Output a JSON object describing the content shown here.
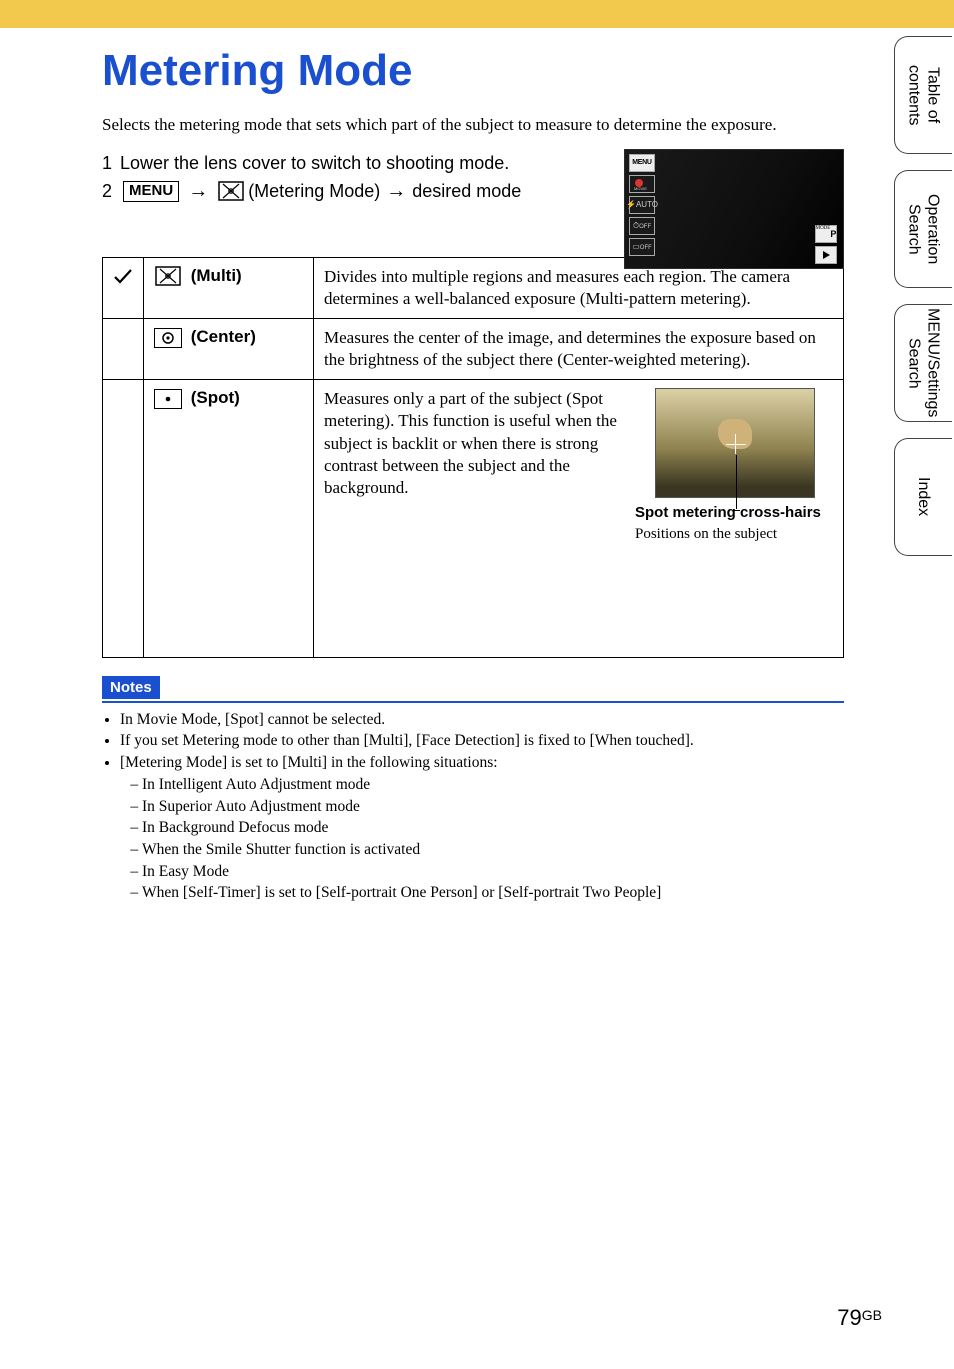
{
  "title": "Metering Mode",
  "intro": "Selects the metering mode that sets which part of the subject to measure to determine the exposure.",
  "steps": {
    "s1_num": "1",
    "s1_text": "Lower the lens cover to switch to shooting mode.",
    "s2_num": "2",
    "s2_menu": "MENU",
    "s2_label": "(Metering Mode)",
    "s2_tail": "desired mode"
  },
  "check_mark": "✓",
  "modes": {
    "multi": {
      "label": "(Multi)",
      "desc": "Divides into multiple regions and measures each region. The camera determines a well-balanced exposure (Multi-pattern metering)."
    },
    "center": {
      "label": "(Center)",
      "desc": "Measures the center of the image, and determines the exposure based on the brightness of the subject there (Center-weighted metering)."
    },
    "spot": {
      "label": "(Spot)",
      "desc": "Measures only a part of the subject (Spot metering). This function is useful when the subject is backlit or when there is strong contrast between the subject and the background.",
      "caption": "Spot metering cross-hairs",
      "subcaption": "Positions on the subject"
    }
  },
  "lcd": {
    "menu": "MENU",
    "movie": "MOVIE",
    "flash": "AUTO",
    "timer": "OFF",
    "drive": "OFF",
    "mode": "MODE",
    "p": "P"
  },
  "notes": {
    "title": "Notes",
    "items": [
      "In Movie Mode, [Spot] cannot be selected.",
      "If you set Metering mode to other than [Multi], [Face Detection] is fixed to [When touched].",
      "[Metering Mode] is set to [Multi] in the following situations:"
    ],
    "subitems": [
      "In Intelligent Auto Adjustment mode",
      "In Superior Auto Adjustment mode",
      "In Background Defocus mode",
      "When the Smile Shutter function is activated",
      "In Easy Mode",
      "When [Self-Timer] is set to [Self-portrait One Person] or [Self-portrait Two People]"
    ]
  },
  "side_tabs": [
    "Table of contents",
    "Operation Search",
    "MENU/Settings Search",
    "Index"
  ],
  "page_number": "79",
  "page_suffix": "GB"
}
